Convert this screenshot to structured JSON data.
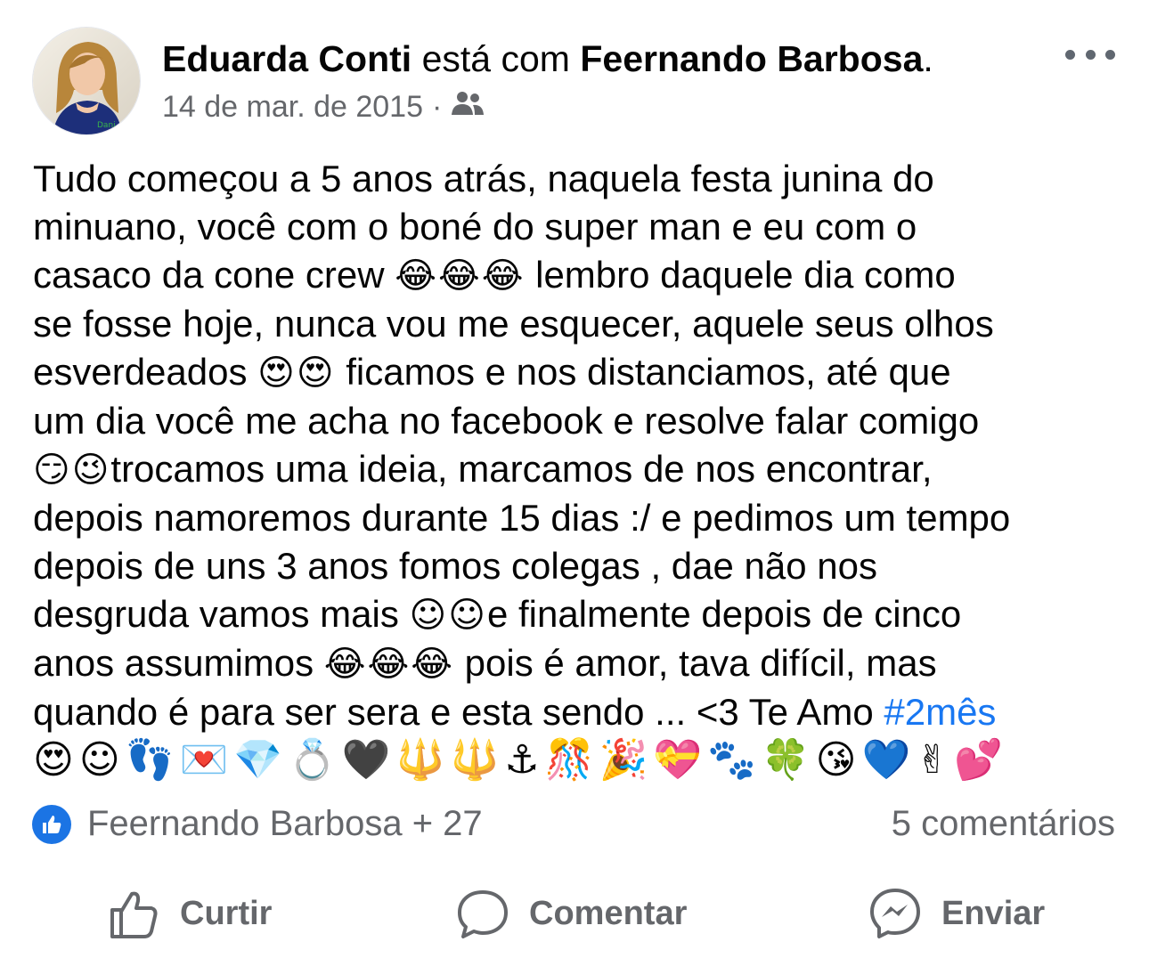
{
  "post": {
    "author": "Eduarda Conti",
    "with_text": "está com",
    "tagged": "Feernando Barbosa",
    "period": ".",
    "date": "14 de mar. de 2015",
    "separator": "·",
    "audience_icon": "friends-icon",
    "avatar_icon": "profile-photo",
    "lines": [
      {
        "a": "Tudo começou a 5 anos atrás, naquela festa junina do"
      },
      {
        "a": "minuano, você com o boné do super man e eu com o"
      },
      {
        "a": "casaco da cone crew ",
        "e": "😂😂😂",
        "b": " lembro daquele dia como"
      },
      {
        "a": "se fosse hoje, nunca vou me esquecer, aquele seus olhos"
      },
      {
        "a": "esverdeados ",
        "e": "😍😍",
        "b": " ficamos e nos distanciamos, até que"
      },
      {
        "a": "um dia você me acha no facebook e resolve falar comigo"
      },
      {
        "a": "",
        "e": "😏😉",
        "b": "trocamos uma ideia, marcamos  de nos encontrar,"
      },
      {
        "a": "depois namoremos durante 15 dias :/ e pedimos um tempo"
      },
      {
        "a": "depois de uns 3 anos fomos colegas , dae não nos"
      },
      {
        "a": "desgruda vamos mais ",
        "e": "☺☺",
        "b": "e finalmente depois de cinco"
      },
      {
        "a": "anos assumimos ",
        "e": "😂😂😂",
        "b": " pois é amor, tava difícil, mas"
      }
    ],
    "last_line": "quando é para ser sera e esta sendo ... <3 Te Amo ",
    "hashtag": "#2mês",
    "emoji_row": "😍☺👣💌💎💍🖤🔱🔱⚓🎊🎉💝🐾🍀😘💙✌💕"
  },
  "reactions": {
    "icon": "like-icon",
    "text": "Feernando Barbosa + 27",
    "comments": "5 comentários"
  },
  "actions": {
    "like": "Curtir",
    "comment": "Comentar",
    "send": "Enviar"
  },
  "colors": {
    "link": "#1877f2",
    "secondary": "#65676b",
    "like_badge": "#1b74e4"
  }
}
